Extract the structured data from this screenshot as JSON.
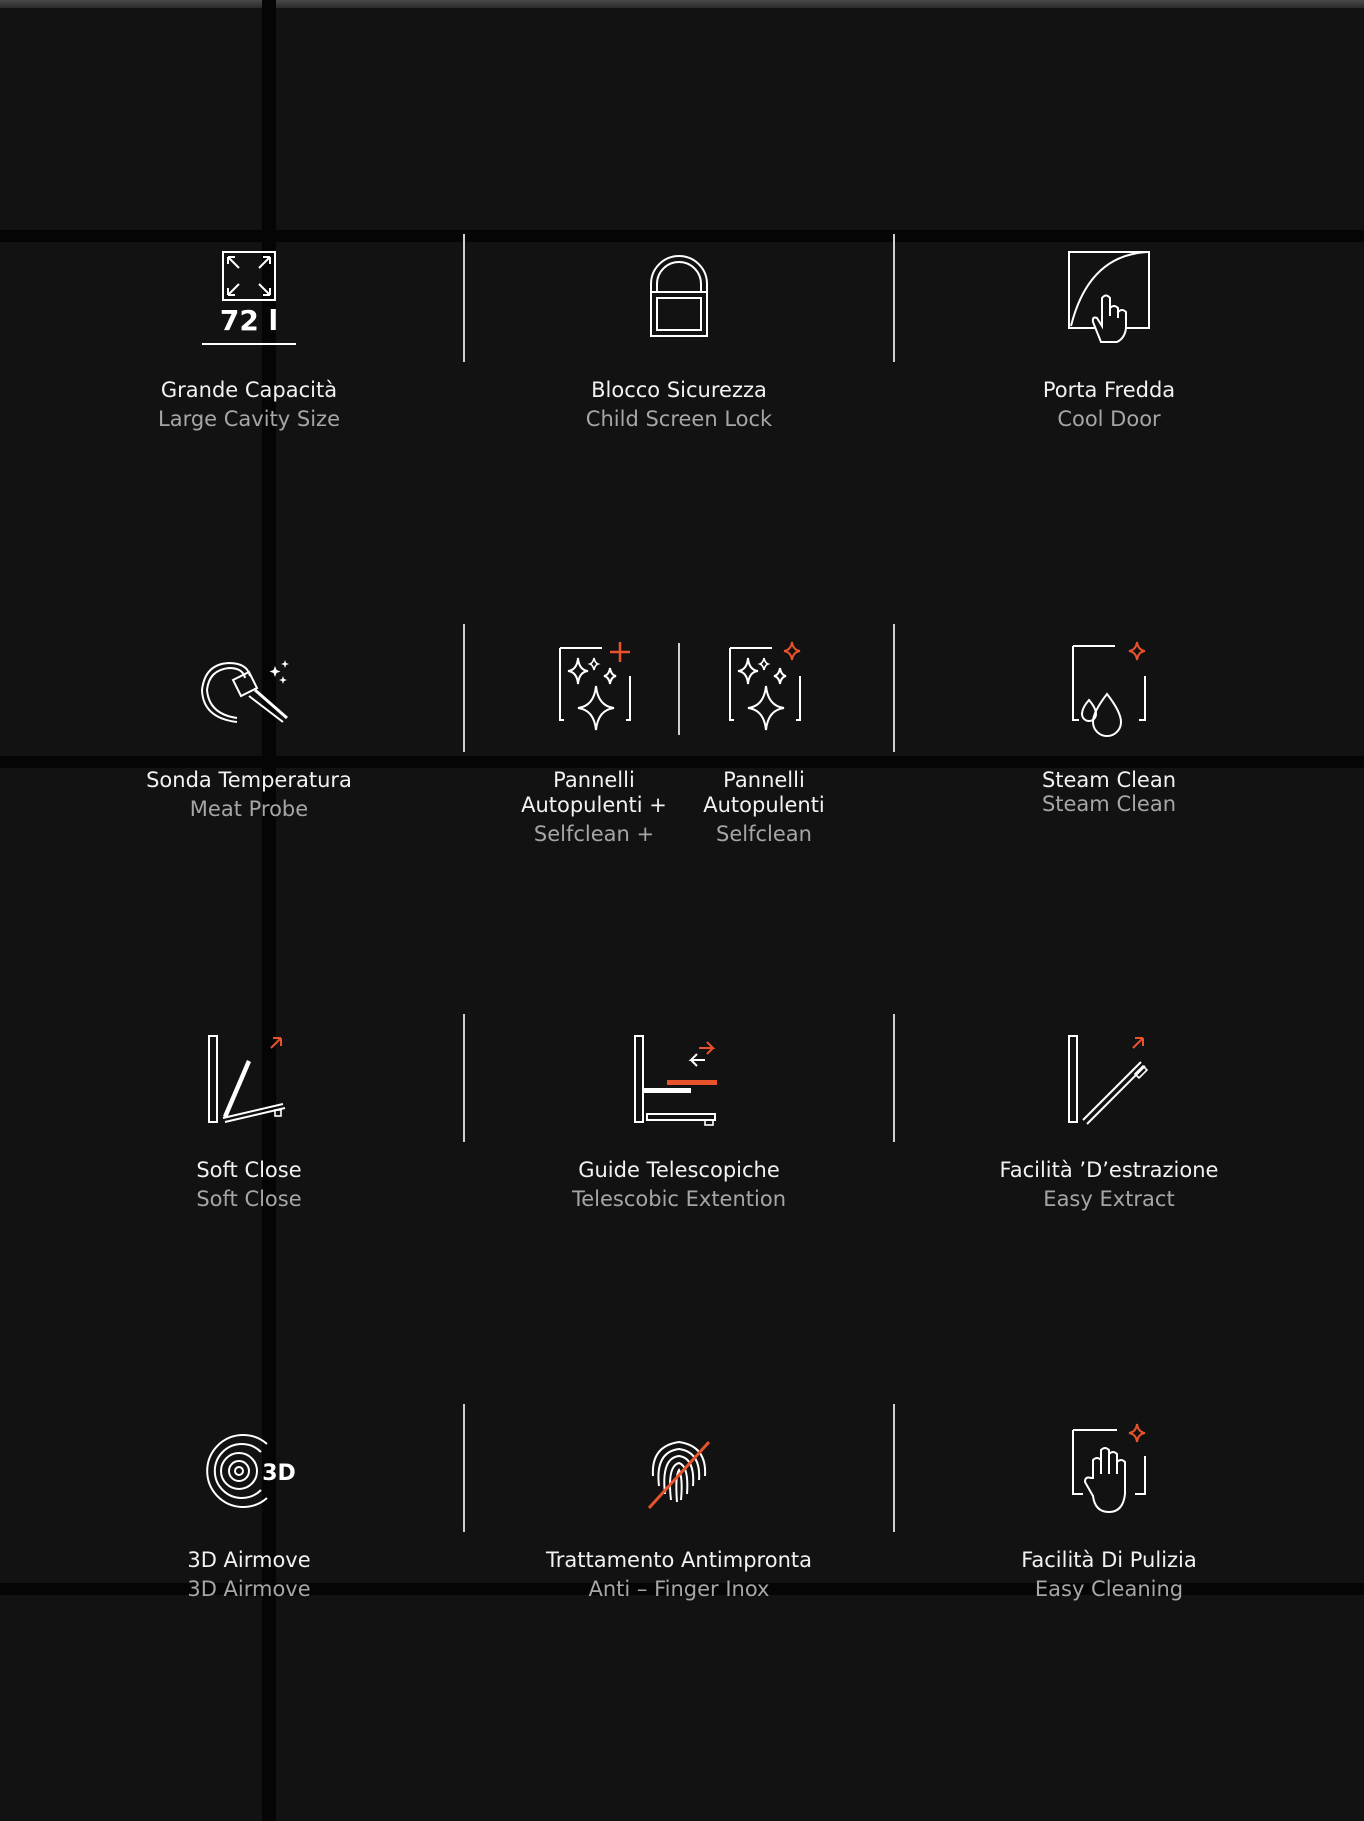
{
  "page": {
    "background": "#121212",
    "accent": "#e8532c"
  },
  "features": [
    {
      "icon": "expand-arrows-icon",
      "badge": "72 l",
      "it": "Grande Capacità",
      "en": "Large Cavity Size"
    },
    {
      "icon": "padlock-icon",
      "it": "Blocco Sicurezza",
      "en": "Child Screen Lock"
    },
    {
      "icon": "cool-door-touch-icon",
      "it": "Porta Fredda",
      "en": "Cool Door"
    },
    {
      "icon": "meat-probe-icon",
      "it": "Sonda Temperatura",
      "en": "Meat Probe"
    },
    {
      "icon": "selfclean-plus-icon",
      "it": "Pannelli\nAutopulenti +",
      "en": "Selfclean +"
    },
    {
      "icon": "selfclean-icon",
      "it": "Pannelli\nAutopulenti",
      "en": "Selfclean"
    },
    {
      "icon": "steam-drop-icon",
      "it": "Steam Clean",
      "en": "Steam Clean"
    },
    {
      "icon": "soft-close-door-icon",
      "it": "Soft Close",
      "en": "Soft Close"
    },
    {
      "icon": "telescopic-rails-icon",
      "it": "Guide Telescopiche",
      "en": "Telescobic Extention"
    },
    {
      "icon": "easy-extract-icon",
      "it": "Facilità ’D’estrazione",
      "en": "Easy Extract"
    },
    {
      "icon": "3d-airmove-icon",
      "badge": "3D",
      "it": "3D Airmove",
      "en": "3D Airmove"
    },
    {
      "icon": "fingerprint-crossed-icon",
      "it": "Trattamento Antimpronta",
      "en": "Anti – Finger Inox"
    },
    {
      "icon": "hand-clean-icon",
      "it": "Facilità Di Pulizia",
      "en": "Easy Cleaning"
    }
  ]
}
